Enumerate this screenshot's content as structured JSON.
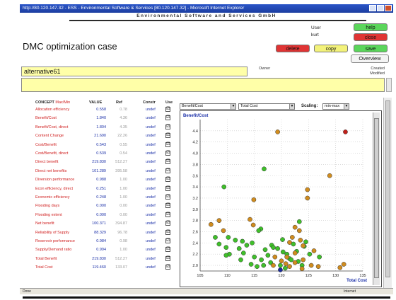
{
  "window": {
    "title": "http://80.120.147.32 - ESS - Environmental Software & Services [80.120.147.32] - Microsoft Internet Explorer"
  },
  "company": "Environmental Software and Services GmbH",
  "page_title": "DMC optimization case",
  "user": {
    "label": "User",
    "value": "kurt"
  },
  "buttons": {
    "help": "help",
    "close": "close",
    "delete": "delete",
    "copy": "copy",
    "save": "save",
    "overview": "Overview"
  },
  "case": {
    "name": "alternative61",
    "owner_label": "Owner",
    "created_label": "Created",
    "modified_label": "Modified"
  },
  "table": {
    "headers": {
      "concept": "CONCEPT",
      "maxmin": "Max/Min",
      "value": "VALUE",
      "ref": "Ref",
      "constr": "Constr",
      "use": "Use"
    },
    "rows": [
      {
        "concept": "Allocation efficiency",
        "value": "0.558",
        "ref": "0.78",
        "constr": "undef",
        "use": "☑"
      },
      {
        "concept": "Benefit/Cost",
        "value": "1.840",
        "ref": "4.36",
        "constr": "undef",
        "use": "☑"
      },
      {
        "concept": "Benefit/Cost, direct",
        "value": "1.804",
        "ref": "4.35",
        "constr": "undef",
        "use": "☑"
      },
      {
        "concept": "Content Change",
        "value": "21.690",
        "ref": "22.26",
        "constr": "undef",
        "use": "☑"
      },
      {
        "concept": "Cost/Benefit",
        "value": "0.543",
        "ref": "0.55",
        "constr": "undef",
        "use": "☑"
      },
      {
        "concept": "Cost/Benefit, direct",
        "value": "0.539",
        "ref": "0.54",
        "constr": "undef",
        "use": "☑"
      },
      {
        "concept": "Direct benefit",
        "value": "219.830",
        "ref": "512.27",
        "constr": "undef",
        "use": "☑"
      },
      {
        "concept": "Direct net benefits",
        "value": "101.289",
        "ref": "395.58",
        "constr": "undef",
        "use": "☑"
      },
      {
        "concept": "Diversion performance",
        "value": "0.988",
        "ref": "1.00",
        "constr": "undef",
        "use": "☑"
      },
      {
        "concept": "Econ efficiency, direct",
        "value": "0.251",
        "ref": "1.00",
        "constr": "undef",
        "use": "☑"
      },
      {
        "concept": "Economic efficiency",
        "value": "0.248",
        "ref": "1.00",
        "constr": "undef",
        "use": "☑"
      },
      {
        "concept": "Flooding days",
        "value": "0.000",
        "ref": "0.00",
        "constr": "undef",
        "use": "☑"
      },
      {
        "concept": "Flooding extent",
        "value": "0.000",
        "ref": "0.00",
        "constr": "undef",
        "use": "☑"
      },
      {
        "concept": "Net benefit",
        "value": "100.371",
        "ref": "394.87",
        "constr": "undef",
        "use": "☑"
      },
      {
        "concept": "Reliability of Supply",
        "value": "88.329",
        "ref": "96.78",
        "constr": "undef",
        "use": "☑"
      },
      {
        "concept": "Reservoir performance",
        "value": "0.984",
        "ref": "0.98",
        "constr": "undef",
        "use": "☑"
      },
      {
        "concept": "Supply/Demand ratio",
        "value": "0.994",
        "ref": "1.00",
        "constr": "undef",
        "use": "☑"
      },
      {
        "concept": "Total Benefit",
        "value": "219.830",
        "ref": "512.27",
        "constr": "undef",
        "use": "☑"
      },
      {
        "concept": "Total Cost",
        "value": "119.460",
        "ref": "133.07",
        "constr": "undef",
        "use": "☑"
      }
    ]
  },
  "chart_controls": {
    "y_select": "Benefit/Cost",
    "x_select": "Total Cost",
    "scaling_label": "Scaling:",
    "scaling_select": "min-max"
  },
  "colors": {
    "feasible": "#3fbf2a",
    "alternative": "#d08c1e",
    "reference": "#c0201a",
    "current": "#1a2a9a"
  },
  "chart_data": {
    "type": "scatter",
    "title": "",
    "ylabel": "Benefit/Cost",
    "xlabel": "Total Cost",
    "xlim": [
      105,
      135
    ],
    "ylim": [
      1.9,
      4.6
    ],
    "xticks": [
      105,
      110,
      115,
      120,
      125,
      130,
      135
    ],
    "yticks": [
      2.0,
      2.2,
      2.4,
      2.6,
      2.8,
      3.0,
      3.2,
      3.4,
      3.6,
      3.8,
      4.0,
      4.2,
      4.4
    ],
    "grid": true,
    "series": [
      {
        "color_key": "feasible",
        "points": [
          [
            116.8,
            3.72
          ],
          [
            109.4,
            3.4
          ],
          [
            107.8,
            2.5
          ],
          [
            116.2,
            2.65
          ],
          [
            115.8,
            2.62
          ],
          [
            123.3,
            2.78
          ],
          [
            120.2,
            2.46
          ],
          [
            108.5,
            2.38
          ],
          [
            109.8,
            2.32
          ],
          [
            111.5,
            2.45
          ],
          [
            113.6,
            2.36
          ],
          [
            112.2,
            2.3
          ],
          [
            110.4,
            2.2
          ],
          [
            113.0,
            2.22
          ],
          [
            115.0,
            2.15
          ],
          [
            117.0,
            2.28
          ],
          [
            118.2,
            2.36
          ],
          [
            119.3,
            2.3
          ],
          [
            122.2,
            2.38
          ],
          [
            124.2,
            2.34
          ],
          [
            125.2,
            2.2
          ],
          [
            121.5,
            2.12
          ],
          [
            119.8,
            2.0
          ],
          [
            118.0,
            2.05
          ],
          [
            116.3,
            2.1
          ],
          [
            114.4,
            2.02
          ],
          [
            112.5,
            2.1
          ],
          [
            116.7,
            2.0
          ],
          [
            121.0,
            2.2
          ],
          [
            123.1,
            2.07
          ],
          [
            127.0,
            2.15
          ],
          [
            120.7,
            1.95
          ],
          [
            123.8,
            2.0
          ],
          [
            121.8,
            2.1
          ],
          [
            120.3,
            2.24
          ],
          [
            109.8,
            2.18
          ],
          [
            112.8,
            2.43
          ],
          [
            114.6,
            2.4
          ],
          [
            118.5,
            2.32
          ],
          [
            117.5,
            2.18
          ],
          [
            122.8,
            2.25
          ],
          [
            115.5,
            1.98
          ],
          [
            124.5,
            2.42
          ],
          [
            110.2,
            2.5
          ]
        ]
      },
      {
        "color_key": "alternative",
        "points": [
          [
            119.3,
            4.38
          ],
          [
            128.9,
            3.6
          ],
          [
            124.8,
            3.35
          ],
          [
            114.9,
            3.17
          ],
          [
            124.8,
            3.2
          ],
          [
            107.0,
            2.73
          ],
          [
            108.5,
            2.8
          ],
          [
            114.2,
            2.82
          ],
          [
            122.5,
            2.68
          ],
          [
            123.3,
            2.62
          ],
          [
            109.3,
            2.62
          ],
          [
            122.0,
            2.5
          ],
          [
            123.5,
            2.45
          ],
          [
            121.5,
            2.41
          ],
          [
            124.0,
            2.35
          ],
          [
            126.0,
            2.26
          ],
          [
            122.5,
            2.22
          ],
          [
            121.0,
            2.15
          ],
          [
            120.0,
            2.08
          ],
          [
            122.5,
            2.05
          ],
          [
            124.0,
            2.1
          ],
          [
            125.5,
            2.0
          ],
          [
            126.8,
            1.98
          ],
          [
            123.8,
            1.94
          ],
          [
            120.8,
            2.03
          ],
          [
            118.8,
            2.15
          ],
          [
            121.5,
            1.98
          ],
          [
            131.5,
            2.02
          ],
          [
            130.8,
            1.96
          ],
          [
            118.5,
            2.0
          ],
          [
            114.8,
            2.72
          ]
        ]
      },
      {
        "color_key": "reference",
        "points": [
          [
            131.8,
            4.38
          ]
        ]
      },
      {
        "color_key": "current",
        "points": [
          [
            119.8,
            1.92
          ]
        ]
      }
    ]
  },
  "statusbar": {
    "left": "Done",
    "zone": "Internet"
  }
}
